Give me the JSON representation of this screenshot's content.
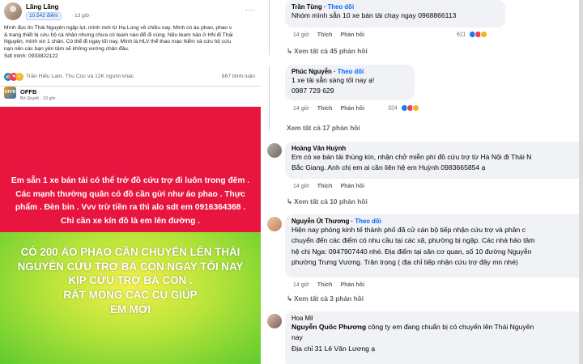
{
  "post1": {
    "author": "Lãng Lãng",
    "badge": "10.542 điểm",
    "time": "· 13 giờ ·",
    "more": "···",
    "body_lines": [
      "Mình đọc tin Thái Nguyên ngập lụt, mình mới từ Hạ Long về chiều nay. Mình có áo phao, phao v",
      "& trang thiết bị cứu hộ cá nhân nhưng chưa có team nào để đi cùng. Nếu team nào ở HN đi Thái",
      "Nguyên, mình xin 1 chân. Có thể đi ngay tối nay. Mình là HLV thể thao mạo hiểm và cứu hộ cứu",
      "nạn nên các bạn yên tâm sẽ không vướng chân đâu.",
      "Sdt mình: 0933822122"
    ],
    "reacters": "Trần Hiếu Lam, Thu Cúc và 12K người khác",
    "comments_count": "867 bình luận"
  },
  "post2": {
    "author": "OFFB",
    "avatar_text": "OFFB",
    "meta": "Bé Quyết · 13 giờ ·"
  },
  "card_red": {
    "text": "Em sẵn 1 xe bán tải có thể trở đồ cứu trợ đi luôn trong đêm . Các mạnh thường quân có đồ cần gửi như áo phao . Thực phẩm . Đèn bin . Vvv trừ tiền ra thì alo sdt em 0916364368 . Chỉ cần xe kín đồ là em lên đường .",
    "color": "#e8163f"
  },
  "card_green": {
    "lines": [
      "CÓ 200 ÁO PHAO CẦN CHUYỂN LÊN THÁI",
      "NGUYÊN CỨU TRỢ BÀ CON NGAY TỐI NAY",
      "KỊP CỨU TRỢ BÀ CON .",
      "RẤT MONG CÁC CỤ GIÚP",
      "EM MỚI"
    ]
  },
  "comments": [
    {
      "name": "Trần Tùng",
      "follow": "Theo dõi",
      "text_lines": [
        "Nhóm mình sẵn 10 xe bán tải chạy ngay 0968866113"
      ],
      "time": "14 giờ",
      "like": "Thích",
      "reply": "Phản hồi",
      "reaction_count": "611",
      "view_more": "Xem tất cả 45 phản hồi"
    },
    {
      "name": "Phúc Nguyễn",
      "follow": "Theo dõi",
      "text_lines": [
        "1 xe tải sẵn sàng tối nay ạ!",
        "0987 729 629"
      ],
      "time": "14 giờ",
      "like": "Thích",
      "reply": "Phản hồi",
      "reaction_count": "324",
      "view_more": "Xem tất cả 17 phản hồi"
    },
    {
      "name": "Hoàng Văn Huỳnh",
      "text_lines": [
        "Em có xe bán tải thùng kín, nhận chở miễn phí đồ cứu trợ từ Hà Nội đi Thái N",
        "Bắc Giang. Anh chị em ai cần liên hệ em Huỳnh 0983665854 ạ"
      ],
      "time": "14 giờ",
      "like": "Thích",
      "reply": "Phản hồi",
      "view_more": "Xem tất cả 10 phản hồi"
    },
    {
      "name": "Nguyễn Út Thương",
      "follow": "Theo dõi",
      "text_lines": [
        "Hiện nay phòng kinh tế thành phố đã cử cán bộ tiếp nhận cứu trợ và phân c",
        "chuyển đến các điểm có nhu cầu tại các xã, phường bị ngập. Các nhà hảo tâm",
        "hệ chị Nga: 0947907440 nhé. Địa điểm tại sân cơ quan, số 10 đường Nguyễn",
        "phường Trưng Vương. Trân trọng ( địa chỉ tiếp nhận cứu trợ đây mn nhé)"
      ],
      "time": "14 giờ",
      "like": "Thích",
      "reply": "Phản hồi",
      "view_more": "Xem tất cả 3 phản hồi"
    },
    {
      "name": "Hoa Mil",
      "mention": "Nguyễn Quốc Phương",
      "text_lines": [
        "công ty em đang chuẩn bị có chuyến lên Thái Nguyên",
        "nay",
        "Địa chỉ 31 Lê Văn Lương ạ"
      ]
    }
  ],
  "colors": {
    "follow_blue": "#0866ff",
    "meta_gray": "#65676b",
    "bubble": "#f0f2f5"
  }
}
